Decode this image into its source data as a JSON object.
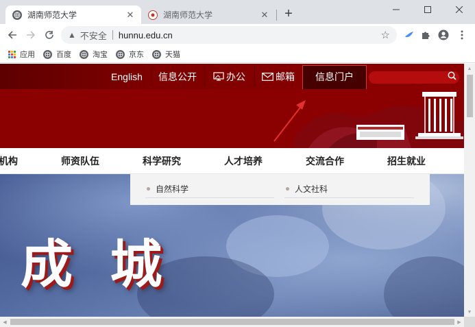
{
  "browser": {
    "tabs": [
      {
        "title": "湖南师范大学",
        "active": true
      },
      {
        "title": "湖南师范大学",
        "active": false
      }
    ],
    "new_tab_icon": "plus-icon",
    "window_controls": [
      "minimize-icon",
      "maximize-icon",
      "close-icon"
    ]
  },
  "toolbar": {
    "security_label": "不安全",
    "url": "hunnu.edu.cn",
    "icons": [
      "back-arrow-icon",
      "forward-arrow-icon",
      "reload-icon",
      "warning-icon",
      "star-icon",
      "bird-extension-icon",
      "puzzle-extensions-icon",
      "profile-icon",
      "menu-dots-icon"
    ]
  },
  "bookmarks": [
    {
      "label": "应用",
      "icon": "apps-grid-icon"
    },
    {
      "label": "百度",
      "icon": "globe-icon"
    },
    {
      "label": "淘宝",
      "icon": "globe-icon"
    },
    {
      "label": "京东",
      "icon": "globe-icon"
    },
    {
      "label": "天猫",
      "icon": "globe-icon"
    }
  ],
  "site": {
    "topnav": {
      "english": "English",
      "public_info": "信息公开",
      "office": "办公",
      "mail": "邮箱",
      "portal": "信息门户"
    },
    "mainnav": [
      "机构",
      "师资队伍",
      "科学研究",
      "人才培养",
      "交流合作",
      "招生就业"
    ],
    "dropdown": [
      "自然科学",
      "人文社科"
    ],
    "hero_text": "成 城",
    "colors": {
      "header_red": "#8b0000",
      "portal_highlight": "#470000",
      "arrow_red": "#e03030"
    }
  }
}
